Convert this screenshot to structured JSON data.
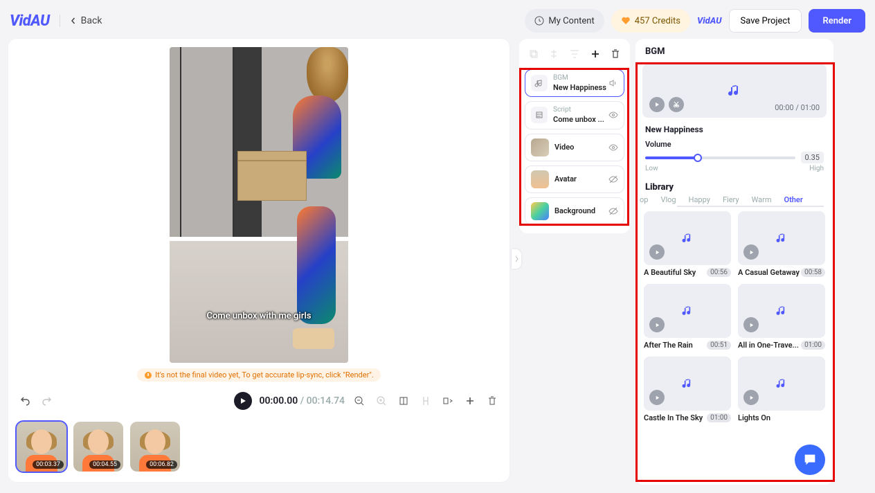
{
  "brand": "VidAU",
  "back": "Back",
  "header": {
    "my_content": "My Content",
    "credits": "457 Credits",
    "save": "Save Project",
    "render": "Render"
  },
  "preview": {
    "caption": "Come unbox with me girls",
    "warning": "It's not the final video yet, To get accurate lip-sync, click \"Render\"."
  },
  "timeline": {
    "current": "00:00.00",
    "duration": "00:14.74",
    "thumbs": [
      "00:03.37",
      "00:04.55",
      "00:06.82"
    ]
  },
  "layers": [
    {
      "type": "BGM",
      "name": "New Happiness",
      "icon": "music",
      "eye": "speaker"
    },
    {
      "type": "Script",
      "name": "Come unbox ...",
      "icon": "script",
      "eye": "eye"
    },
    {
      "type": "",
      "name": "Video",
      "icon": "thumb",
      "eye": "eye"
    },
    {
      "type": "",
      "name": "Avatar",
      "icon": "thumb-av",
      "eye": "eye-off"
    },
    {
      "type": "",
      "name": "Background",
      "icon": "thumb-bg",
      "eye": "eye-off"
    }
  ],
  "bgm": {
    "panel_title": "BGM",
    "now_playing": "New Happiness",
    "time": "00:00 / 01:00",
    "volume_label": "Volume",
    "volume": "0.35",
    "low": "Low",
    "high": "High",
    "library": "Library",
    "tabs": [
      "op",
      "Vlog",
      "Happy",
      "Fiery",
      "Warm",
      "Other"
    ],
    "active_tab": 5,
    "tracks": [
      {
        "name": "A Beautiful Sky",
        "dur": "00:56"
      },
      {
        "name": "A Casual Getaway",
        "dur": "00:58"
      },
      {
        "name": "After The Rain",
        "dur": "00:51"
      },
      {
        "name": "All in One-Trave...",
        "dur": "01:00"
      },
      {
        "name": "Castle In The Sky",
        "dur": "01:00"
      },
      {
        "name": "Lights On",
        "dur": ""
      }
    ]
  }
}
